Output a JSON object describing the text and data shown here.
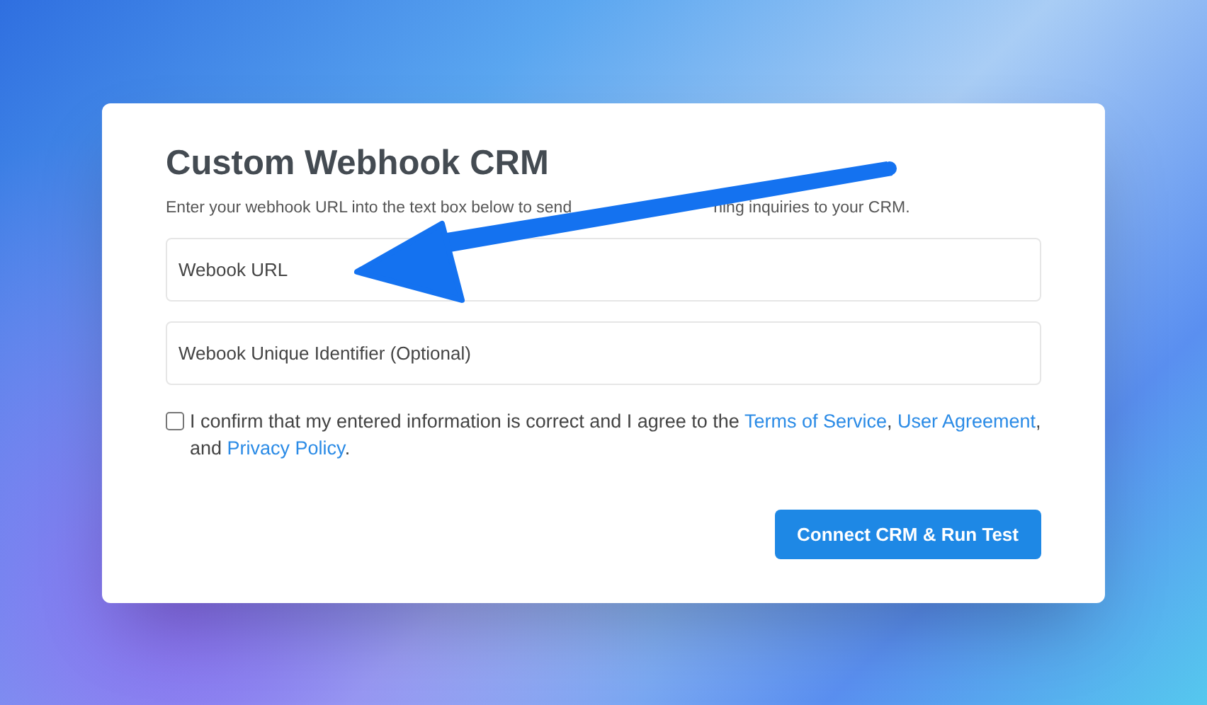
{
  "title": "Custom Webhook CRM",
  "subtitle_parts": [
    "Enter your webhook URL into the text box below to send",
    "ning inquiries to your CRM."
  ],
  "fields": [
    {
      "placeholder": "Webook URL"
    },
    {
      "placeholder": "Webook Unique Identifier (Optional)"
    }
  ],
  "consent": {
    "checked": false,
    "segments": [
      {
        "kind": "text",
        "text": "I confirm that my entered information is correct and I agree to the "
      },
      {
        "kind": "link",
        "text": "Terms of Service"
      },
      {
        "kind": "text",
        "text": ", "
      },
      {
        "kind": "link",
        "text": "User Agreement"
      },
      {
        "kind": "text",
        "text": ", and "
      },
      {
        "kind": "link",
        "text": "Privacy Policy"
      },
      {
        "kind": "text",
        "text": "."
      }
    ]
  },
  "button": "Connect CRM & Run Test"
}
